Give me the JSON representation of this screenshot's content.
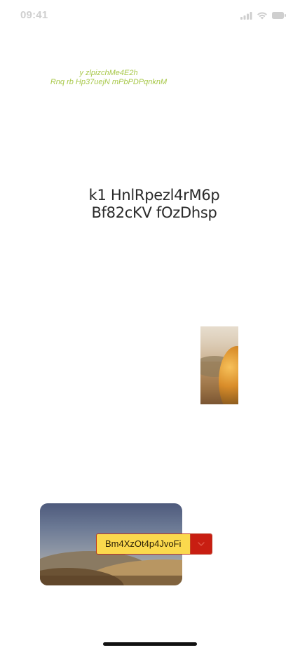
{
  "status_bar": {
    "time": "09:41",
    "icons": [
      "signal-icon",
      "wifi-icon",
      "battery-icon"
    ]
  },
  "tagline": {
    "line1": "y zlpizchMe4E2h",
    "line2": "Rnq rb Hp37uejN mPbPDPqnknM"
  },
  "heading": {
    "line1": "k1 HnlRpezl4rM6p",
    "line2": "Bf82cKV fOzDhsp"
  },
  "images": {
    "cactus": "cactus-photo",
    "landscape": "desert-hills-photo"
  },
  "select": {
    "value": "Bm4XzOt4p4JvoFi",
    "icon": "chevron-down-icon"
  },
  "colors": {
    "tagline": "#a8c84a",
    "select_background": "#fbd94d",
    "select_toggle": "#c81e12",
    "select_border": "#b9341e"
  }
}
